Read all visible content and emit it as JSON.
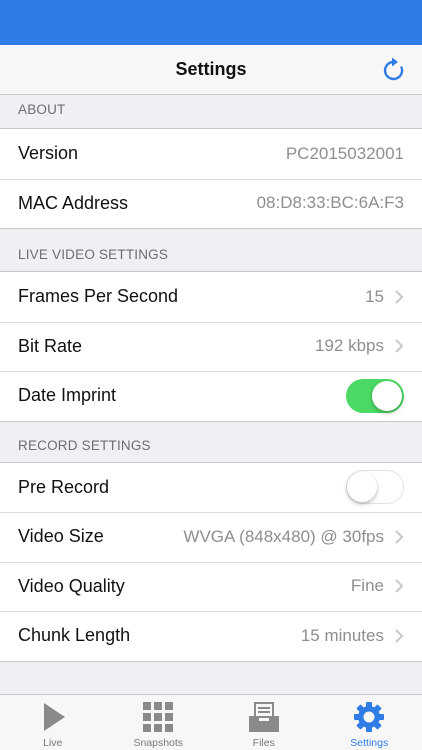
{
  "nav": {
    "title": "Settings"
  },
  "about": {
    "header": "ABOUT",
    "rows": [
      {
        "label": "Version",
        "value": "PC2015032001"
      },
      {
        "label": "MAC Address",
        "value": "08:D8:33:BC:6A:F3"
      }
    ]
  },
  "live_video": {
    "header": "LIVE VIDEO SETTINGS",
    "fps": {
      "label": "Frames Per Second",
      "value": "15"
    },
    "bitrate": {
      "label": "Bit Rate",
      "value": "192 kbps"
    },
    "date_imprint": {
      "label": "Date Imprint",
      "on": true
    }
  },
  "record": {
    "header": "RECORD SETTINGS",
    "pre_record": {
      "label": "Pre Record",
      "on": false
    },
    "video_size": {
      "label": "Video Size",
      "value": "WVGA (848x480) @ 30fps"
    },
    "video_quality": {
      "label": "Video Quality",
      "value": "Fine"
    },
    "chunk_length": {
      "label": "Chunk Length",
      "value": "15 minutes"
    }
  },
  "tabs": [
    {
      "label": "Live",
      "icon": "play-icon"
    },
    {
      "label": "Snapshots",
      "icon": "grid-icon"
    },
    {
      "label": "Files",
      "icon": "files-tray-icon"
    },
    {
      "label": "Settings",
      "icon": "gear-icon",
      "active": true
    }
  ],
  "colors": {
    "accent": "#2f7ce6",
    "toggle_on": "#4cd964",
    "secondary_text": "#8e8e93"
  }
}
